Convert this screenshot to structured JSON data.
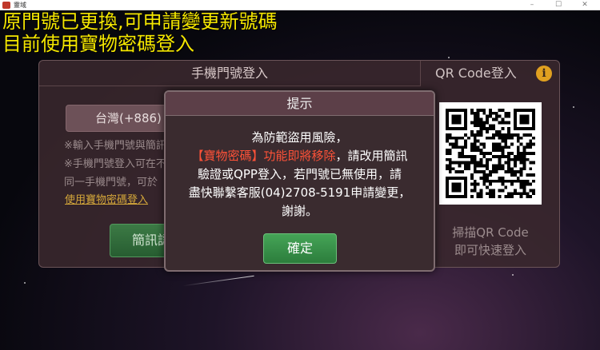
{
  "window": {
    "title": "靈域",
    "min": "–",
    "max": "☐",
    "close": "✕"
  },
  "notice": {
    "line1": "原門號已更換,可申請變更新號碼",
    "line2": "目前使用寶物密碼登入",
    "color": "#f4e600"
  },
  "login": {
    "tab_phone": "手機門號登入",
    "tab_qr": "QR Code登入",
    "info_icon": "i",
    "country": "台灣(+886)",
    "hint1": "※輸入手機門號與簡訊驗證碼",
    "hint2": "※手機門號登入可在不同裝置",
    "hint3": "同一手機門號，可於",
    "gem_link": "使用寶物密碼登入",
    "sms_button": "簡訊認證",
    "qr_caption1": "掃描QR Code",
    "qr_caption2": "即可快速登入"
  },
  "modal": {
    "title": "提示",
    "line1": "為防範盜用風險，",
    "line2_red": "【寶物密碼】功能即將移除",
    "line2_rest": "，請改用簡訊",
    "line3": "驗證或QPP登入，若門號已無使用，請",
    "line4": "盡快聯繫客服(04)2708-5191申請變更，",
    "line5": "謝謝。",
    "ok_button": "確定",
    "highlight_color": "#ff5238"
  }
}
